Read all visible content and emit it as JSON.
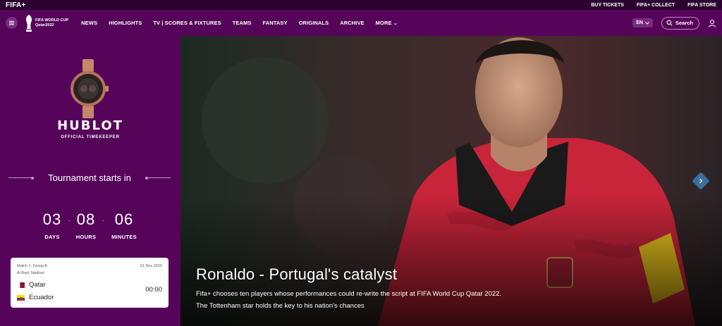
{
  "topbar": {
    "brand": "FIFA+",
    "links": [
      "BUY TICKETS",
      "FIFA+ COLLECT",
      "FIFA STORE"
    ]
  },
  "nav": {
    "logo_line1": "FIFA WORLD CUP",
    "logo_line2": "Qatar2022",
    "items": [
      "NEWS",
      "HIGHLIGHTS",
      "TV | SCORES & FIXTURES",
      "TEAMS",
      "FANTASY",
      "ORIGINALS",
      "ARCHIVE",
      "MORE ⌄"
    ],
    "lang": "EN",
    "search_label": "Search"
  },
  "sponsor": {
    "name": "HUBLOT",
    "tagline": "OFFICIAL TIMEKEEPER"
  },
  "countdown": {
    "title": "Tournament starts in",
    "days": "03",
    "days_label": "DAYS",
    "hours": "08",
    "hours_label": "HOURS",
    "minutes": "06",
    "minutes_label": "MINUTES",
    "separator": "·"
  },
  "match": {
    "group": "Match 1, Group A",
    "date": "21 Nov 2022",
    "stadium": "Al Bayt Stadium",
    "home": "Qatar",
    "away": "Ecuador",
    "time": "00:00"
  },
  "hero": {
    "title": "Ronaldo - Portugal's catalyst",
    "desc_line1": "Fifa+ chooses ten players whose performances could re-write the script at FIFA World Cup Qatar 2022.",
    "desc_line2": "The Tottenham star holds the key to his nation's chances"
  },
  "colors": {
    "brand_purple": "#56045a",
    "topbar_purple": "#2c0330",
    "next_button": "#3a6fa0"
  }
}
